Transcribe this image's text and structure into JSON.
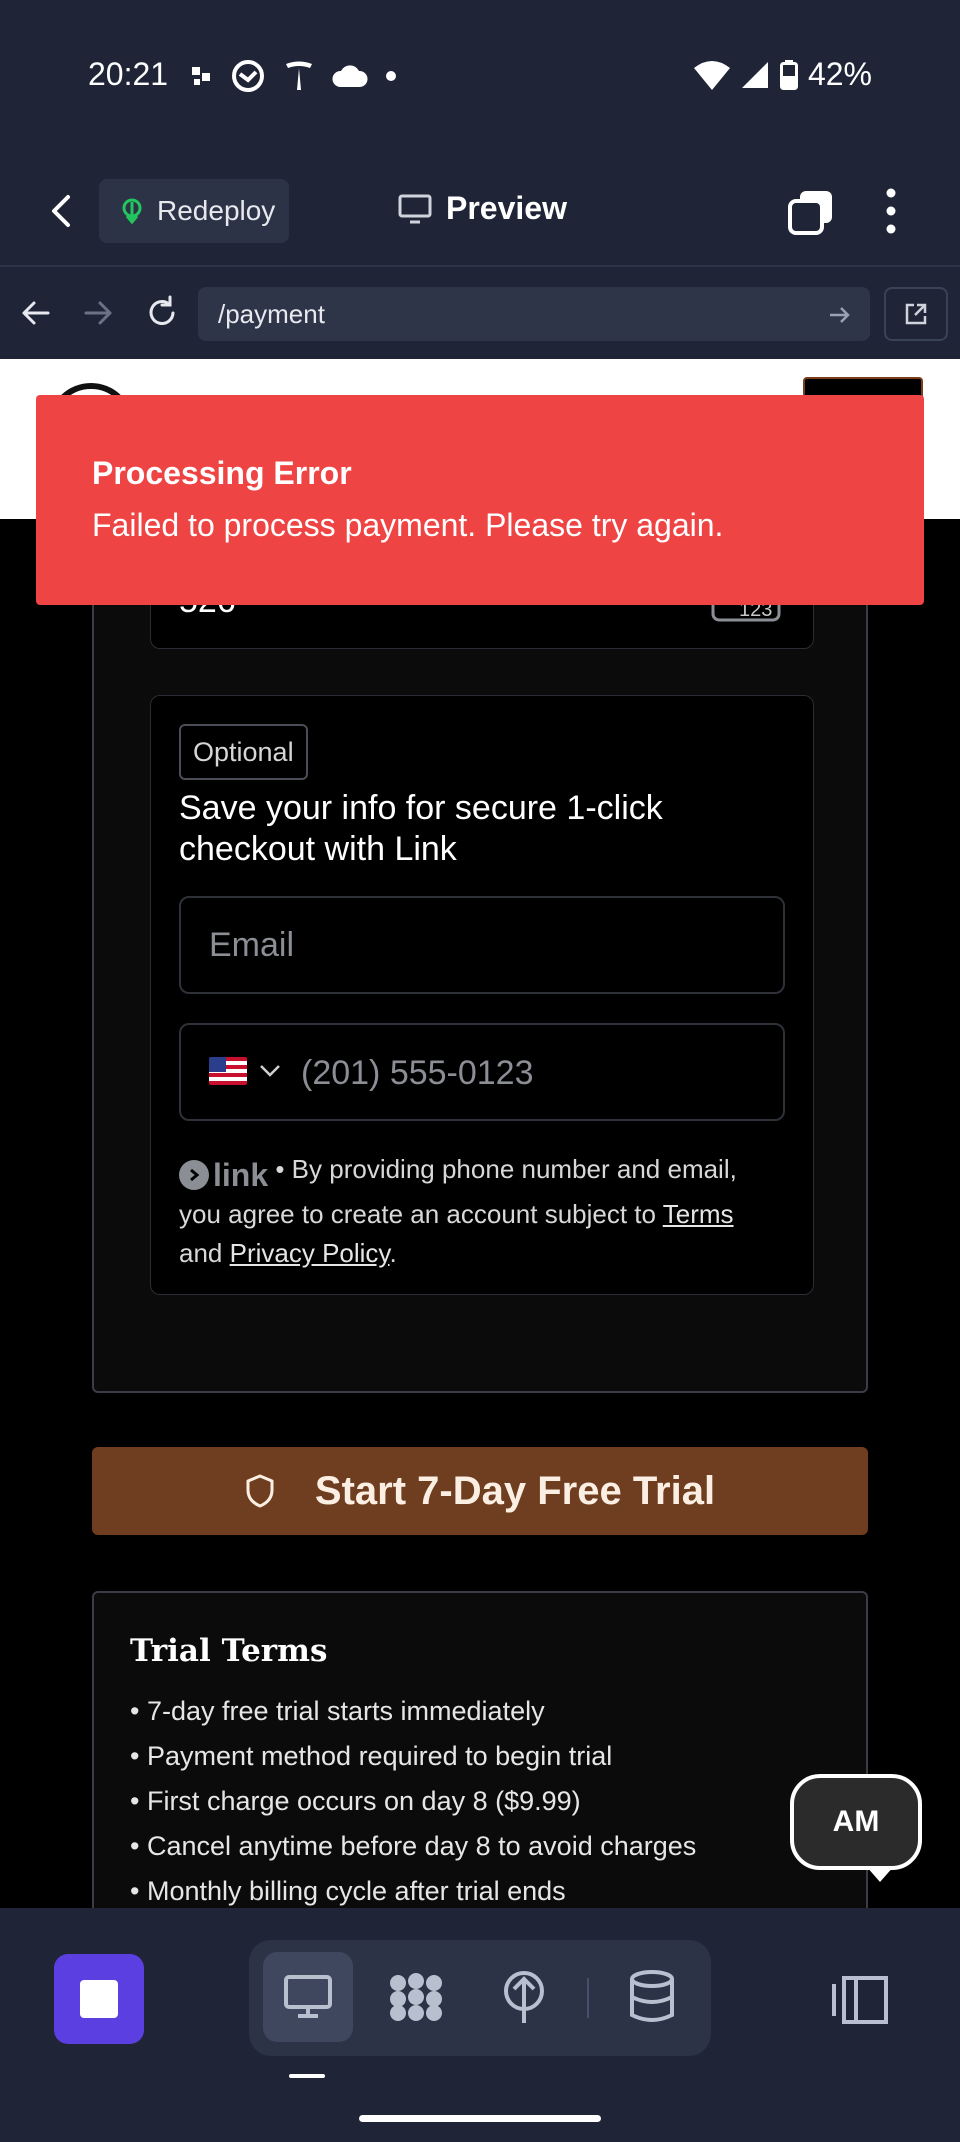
{
  "status_bar": {
    "time": "20:21",
    "battery": "42%"
  },
  "app_header": {
    "redeploy_label": "Redeploy",
    "preview_label": "Preview"
  },
  "browser": {
    "url": "/payment"
  },
  "toast": {
    "title": "Processing Error",
    "message": "Failed to process payment. Please try again."
  },
  "payment_form": {
    "cvc_value": "526",
    "cvc_icon_label": "123",
    "link": {
      "optional_badge": "Optional",
      "heading": "Save your info for secure 1-click checkout with Link",
      "email_placeholder": "Email",
      "phone_placeholder": "(201) 555-0123",
      "country": "US",
      "logo_text": "link",
      "terms_prefix": " • By providing phone number and email, you agree to create an account subject to ",
      "terms_link": "Terms",
      "terms_and": " and ",
      "privacy_link": "Privacy Policy",
      "terms_suffix": "."
    }
  },
  "trial_button": {
    "label": "Start 7-Day Free Trial"
  },
  "trial_terms": {
    "title": "Trial Terms",
    "items": [
      "• 7-day free trial starts immediately",
      "• Payment method required to begin trial",
      "• First charge occurs on day 8 ($9.99)",
      "• Cancel anytime before day 8 to avoid charges",
      "• Monthly billing cycle after trial ends"
    ]
  },
  "avatar": {
    "initials": "AM"
  },
  "colors": {
    "toast_bg": "#ef4444",
    "trial_button_bg": "#6f3d1f",
    "stop_button_bg": "#5b3fe0",
    "chrome_bg": "#1f2537"
  },
  "icons": {
    "status": [
      "notification-icon",
      "mail-icon",
      "tesla-icon",
      "cloud-icon",
      "dot-icon",
      "wifi-icon",
      "signal-icon",
      "battery-icon"
    ],
    "bottom_bar": [
      "stop-icon",
      "desktop-icon",
      "modules-icon",
      "deploy-icon",
      "database-icon",
      "panel-toggle-icon"
    ]
  }
}
